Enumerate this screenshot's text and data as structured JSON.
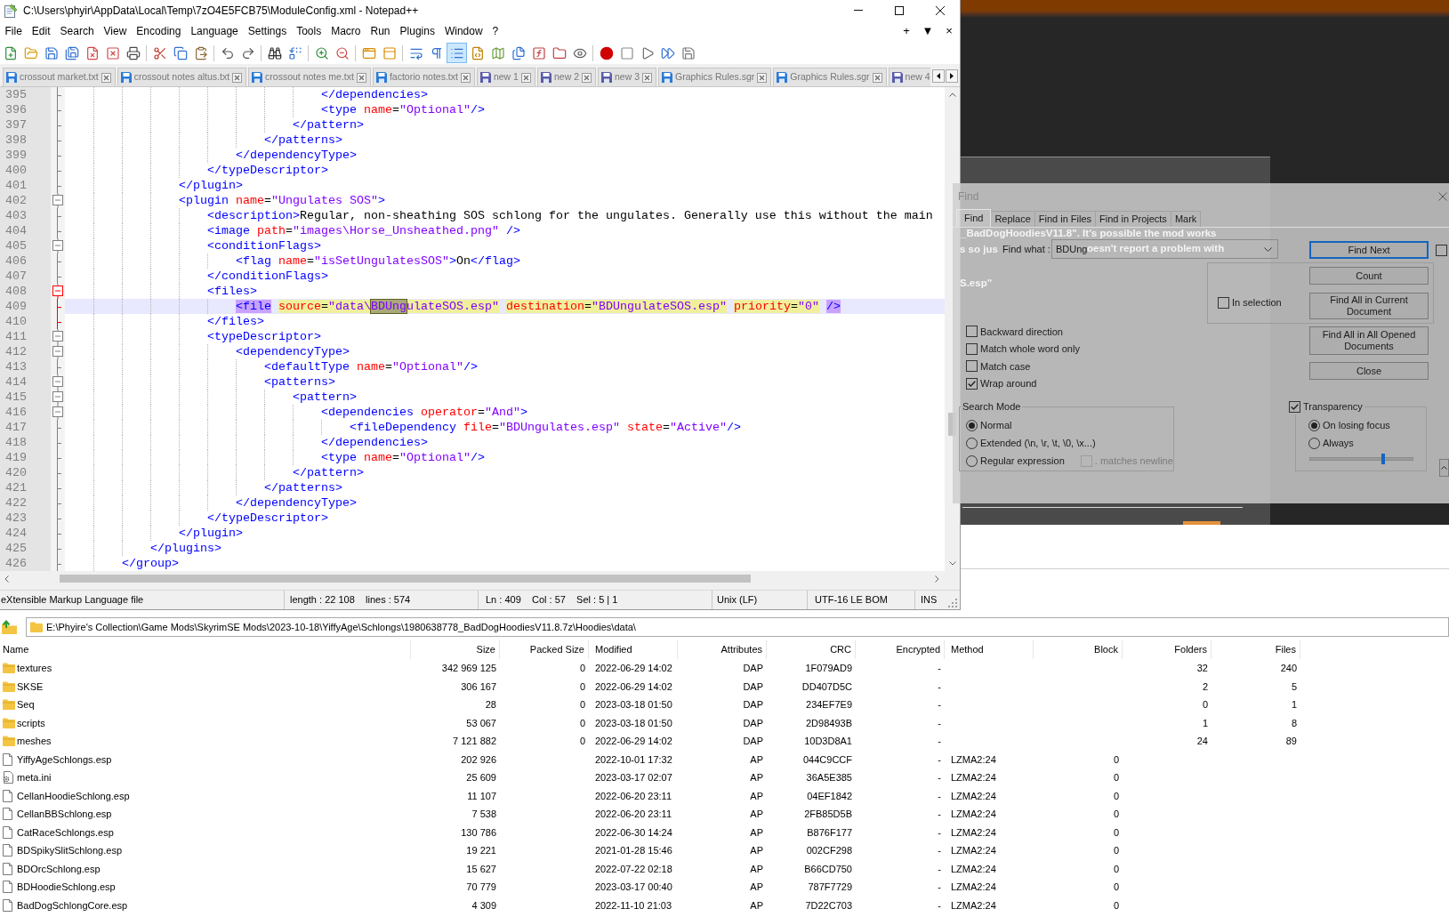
{
  "notepad": {
    "title": "C:\\Users\\phyir\\AppData\\Local\\Temp\\7zO4E5FCB75\\ModuleConfig.xml - Notepad++",
    "menu": [
      "File",
      "Edit",
      "Search",
      "View",
      "Encoding",
      "Language",
      "Settings",
      "Tools",
      "Macro",
      "Run",
      "Plugins",
      "Window",
      "?"
    ],
    "menu_right": [
      "+",
      "▼",
      "×"
    ],
    "toolbar": [
      {
        "pressed": false
      },
      {
        "pressed": false
      },
      {
        "pressed": false
      },
      {
        "pressed": false
      },
      {
        "pressed": false
      },
      {
        "pressed": false
      },
      {
        "pressed": false
      },
      {
        "pressed": false
      },
      {
        "pressed": false
      },
      {
        "pressed": false
      },
      {
        "pressed": false
      },
      {
        "pressed": false
      },
      {
        "pressed": false
      },
      {
        "pressed": false
      },
      {
        "pressed": false
      },
      {
        "pressed": false
      },
      {
        "pressed": false
      },
      {
        "pressed": false
      },
      {
        "pressed": false
      },
      {
        "pressed": false
      },
      {
        "pressed": true
      },
      {
        "pressed": false
      },
      {
        "pressed": false
      },
      {
        "pressed": false
      },
      {
        "pressed": false
      },
      {
        "pressed": false
      },
      {
        "pressed": false
      },
      {
        "pressed": false
      },
      {
        "pressed": false
      },
      {
        "pressed": false
      },
      {
        "pressed": false
      },
      {
        "pressed": false
      }
    ],
    "tabs": [
      {
        "label": "crossout market.txt",
        "selected": false,
        "color": "#2b7bd6"
      },
      {
        "label": "crossout notes altus.txt",
        "selected": false,
        "color": "#2b7bd6"
      },
      {
        "label": "crossout notes me.txt",
        "selected": false,
        "color": "#2b7bd6"
      },
      {
        "label": "factorio notes.txt",
        "selected": false,
        "color": "#2b7bd6"
      },
      {
        "label": "new 1",
        "selected": false,
        "color": "#5b5ba8"
      },
      {
        "label": "new 2",
        "selected": false,
        "color": "#5b5ba8"
      },
      {
        "label": "new 3",
        "selected": false,
        "color": "#5b5ba8"
      },
      {
        "label": "Graphics Rules.sgr",
        "selected": false,
        "color": "#2b7bd6"
      },
      {
        "label": "Graphics Rules.sgr",
        "selected": false,
        "color": "#2b7bd6"
      },
      {
        "label": "new 4",
        "selected": false,
        "color": "#5b5ba8"
      }
    ],
    "lines": [
      {
        "number": "395",
        "fold_start": false,
        "fold_active": false,
        "current": false,
        "tag_match": false,
        "parts": [
          {
            "text": "\t\t\t\t\t\t\t\t\t</dependencies>",
            "selected": false
          }
        ]
      },
      {
        "number": "396",
        "fold_start": false,
        "fold_active": false,
        "current": false,
        "tag_match": false,
        "parts": [
          {
            "text": "\t\t\t\t\t\t\t\t\t<type name=\"Optional\"/>",
            "selected": false
          }
        ]
      },
      {
        "number": "397",
        "fold_start": false,
        "fold_active": false,
        "current": false,
        "tag_match": false,
        "parts": [
          {
            "text": "\t\t\t\t\t\t\t\t</pattern>",
            "selected": false
          }
        ]
      },
      {
        "number": "398",
        "fold_start": false,
        "fold_active": false,
        "current": false,
        "tag_match": false,
        "parts": [
          {
            "text": "\t\t\t\t\t\t\t</patterns>",
            "selected": false
          }
        ]
      },
      {
        "number": "399",
        "fold_start": false,
        "fold_active": false,
        "current": false,
        "tag_match": false,
        "parts": [
          {
            "text": "\t\t\t\t\t\t</dependencyType>",
            "selected": false
          }
        ]
      },
      {
        "number": "400",
        "fold_start": false,
        "fold_active": false,
        "current": false,
        "tag_match": false,
        "parts": [
          {
            "text": "\t\t\t\t\t</typeDescriptor>",
            "selected": false
          }
        ]
      },
      {
        "number": "401",
        "fold_start": false,
        "fold_active": false,
        "current": false,
        "tag_match": false,
        "parts": [
          {
            "text": "\t\t\t\t</plugin>",
            "selected": false
          }
        ]
      },
      {
        "number": "402",
        "fold_start": true,
        "fold_active": false,
        "current": false,
        "tag_match": false,
        "parts": [
          {
            "text": "\t\t\t\t<plugin name=\"Ungulates SOS\">",
            "selected": false
          }
        ]
      },
      {
        "number": "403",
        "fold_start": false,
        "fold_active": false,
        "current": false,
        "tag_match": false,
        "parts": [
          {
            "text": "\t\t\t\t\t<description>Regular, non-sheathing SOS schlong for the ungulates. Generally use this without the main",
            "selected": false
          }
        ]
      },
      {
        "number": "404",
        "fold_start": false,
        "fold_active": false,
        "current": false,
        "tag_match": false,
        "parts": [
          {
            "text": "\t\t\t\t\t<image path=\"images\\Horse_Unsheathed.png\" />",
            "selected": false
          }
        ]
      },
      {
        "number": "405",
        "fold_start": true,
        "fold_active": false,
        "current": false,
        "tag_match": false,
        "parts": [
          {
            "text": "\t\t\t\t\t<conditionFlags>",
            "selected": false
          }
        ]
      },
      {
        "number": "406",
        "fold_start": false,
        "fold_active": false,
        "current": false,
        "tag_match": false,
        "parts": [
          {
            "text": "\t\t\t\t\t\t<flag name=\"isSetUngulatesSOS\">On</flag>",
            "selected": false
          }
        ]
      },
      {
        "number": "407",
        "fold_start": false,
        "fold_active": false,
        "current": false,
        "tag_match": false,
        "parts": [
          {
            "text": "\t\t\t\t\t</conditionFlags>",
            "selected": false
          }
        ]
      },
      {
        "number": "408",
        "fold_start": true,
        "fold_active": true,
        "current": false,
        "tag_match": false,
        "parts": [
          {
            "text": "\t\t\t\t\t<files>",
            "selected": false
          }
        ]
      },
      {
        "number": "409",
        "fold_start": false,
        "fold_active": true,
        "current": true,
        "tag_match": true,
        "parts": [
          {
            "text": "\t\t\t\t\t\t<file source=\"data\\",
            "selected": false
          },
          {
            "text": "BDUng",
            "selected": true
          },
          {
            "text": "ulateSOS.esp\" destination=\"BDUngulateSOS.esp\" priority=\"0\" />",
            "selected": false
          }
        ]
      },
      {
        "number": "410",
        "fold_start": false,
        "fold_active": true,
        "current": false,
        "tag_match": false,
        "parts": [
          {
            "text": "\t\t\t\t\t</files>",
            "selected": false
          }
        ]
      },
      {
        "number": "411",
        "fold_start": true,
        "fold_active": false,
        "current": false,
        "tag_match": false,
        "parts": [
          {
            "text": "\t\t\t\t\t<typeDescriptor>",
            "selected": false
          }
        ]
      },
      {
        "number": "412",
        "fold_start": true,
        "fold_active": false,
        "current": false,
        "tag_match": false,
        "parts": [
          {
            "text": "\t\t\t\t\t\t<dependencyType>",
            "selected": false
          }
        ]
      },
      {
        "number": "413",
        "fold_start": false,
        "fold_active": false,
        "current": false,
        "tag_match": false,
        "parts": [
          {
            "text": "\t\t\t\t\t\t\t<defaultType name=\"Optional\"/>",
            "selected": false
          }
        ]
      },
      {
        "number": "414",
        "fold_start": true,
        "fold_active": false,
        "current": false,
        "tag_match": false,
        "parts": [
          {
            "text": "\t\t\t\t\t\t\t<patterns>",
            "selected": false
          }
        ]
      },
      {
        "number": "415",
        "fold_start": true,
        "fold_active": false,
        "current": false,
        "tag_match": false,
        "parts": [
          {
            "text": "\t\t\t\t\t\t\t\t<pattern>",
            "selected": false
          }
        ]
      },
      {
        "number": "416",
        "fold_start": true,
        "fold_active": false,
        "current": false,
        "tag_match": false,
        "parts": [
          {
            "text": "\t\t\t\t\t\t\t\t\t<dependencies operator=\"And\">",
            "selected": false
          }
        ]
      },
      {
        "number": "417",
        "fold_start": false,
        "fold_active": false,
        "current": false,
        "tag_match": false,
        "parts": [
          {
            "text": "\t\t\t\t\t\t\t\t\t\t<fileDependency file=\"BDUngulates.esp\" state=\"Active\"/>",
            "selected": false
          }
        ]
      },
      {
        "number": "418",
        "fold_start": false,
        "fold_active": false,
        "current": false,
        "tag_match": false,
        "parts": [
          {
            "text": "\t\t\t\t\t\t\t\t\t</dependencies>",
            "selected": false
          }
        ]
      },
      {
        "number": "419",
        "fold_start": false,
        "fold_active": false,
        "current": false,
        "tag_match": false,
        "parts": [
          {
            "text": "\t\t\t\t\t\t\t\t\t<type name=\"Optional\"/>",
            "selected": false
          }
        ]
      },
      {
        "number": "420",
        "fold_start": false,
        "fold_active": false,
        "current": false,
        "tag_match": false,
        "parts": [
          {
            "text": "\t\t\t\t\t\t\t\t</pattern>",
            "selected": false
          }
        ]
      },
      {
        "number": "421",
        "fold_start": false,
        "fold_active": false,
        "current": false,
        "tag_match": false,
        "parts": [
          {
            "text": "\t\t\t\t\t\t\t</patterns>",
            "selected": false
          }
        ]
      },
      {
        "number": "422",
        "fold_start": false,
        "fold_active": false,
        "current": false,
        "tag_match": false,
        "parts": [
          {
            "text": "\t\t\t\t\t\t</dependencyType>",
            "selected": false
          }
        ]
      },
      {
        "number": "423",
        "fold_start": false,
        "fold_active": false,
        "current": false,
        "tag_match": false,
        "parts": [
          {
            "text": "\t\t\t\t\t</typeDescriptor>",
            "selected": false
          }
        ]
      },
      {
        "number": "424",
        "fold_start": false,
        "fold_active": false,
        "current": false,
        "tag_match": false,
        "parts": [
          {
            "text": "\t\t\t\t</plugin>",
            "selected": false
          }
        ]
      },
      {
        "number": "425",
        "fold_start": false,
        "fold_active": false,
        "current": false,
        "tag_match": false,
        "parts": [
          {
            "text": "\t\t\t</plugins>",
            "selected": false
          }
        ]
      },
      {
        "number": "426",
        "fold_start": false,
        "fold_active": false,
        "current": false,
        "tag_match": false,
        "parts": [
          {
            "text": "\t\t</group>",
            "selected": false
          }
        ]
      }
    ],
    "status_bar": [
      "eXtensible Markup Language file",
      "length : 22 108    lines : 574",
      "Ln : 409    Col : 57    Sel : 5 | 1",
      "Unix (LF)",
      "UTF-16 LE BOM",
      "INS"
    ]
  },
  "background_window": {
    "lines": [
      "_BadDogHoodiesV11.8\". It's possible the mod works",
      "s so jus",
      "oesn't report a problem with",
      "S.esp\""
    ]
  },
  "find_dialog": {
    "title": "Find",
    "tabs": [
      {
        "label": "Find",
        "selected": true
      },
      {
        "label": "Replace",
        "selected": false
      },
      {
        "label": "Find in Files",
        "selected": false
      },
      {
        "label": "Find in Projects",
        "selected": false
      },
      {
        "label": "Mark",
        "selected": false
      }
    ],
    "find_what": {
      "label": "Find what :",
      "value": "BDUng"
    },
    "buttons": [
      {
        "label": "Find Next",
        "default": true
      },
      {
        "label": "Count",
        "default": false
      },
      {
        "label": "Find All in Current Document",
        "default": false
      },
      {
        "label": "Find All in All Opened Documents",
        "default": false
      },
      {
        "label": "Close",
        "default": false
      }
    ],
    "unlabeled_checkbox": {
      "checked": false
    },
    "in_selection": {
      "label": "In selection",
      "checked": false
    },
    "options": [
      {
        "label": "Backward direction",
        "checked": false
      },
      {
        "label": "Match whole word only",
        "checked": false
      },
      {
        "label": "Match case",
        "checked": false
      },
      {
        "label": "Wrap around",
        "checked": true
      }
    ],
    "search_mode": {
      "title": "Search Mode",
      "modes": [
        {
          "label": "Normal",
          "selected": true
        },
        {
          "label": "Extended (\\n, \\r, \\t, \\0, \\x...)",
          "selected": false
        },
        {
          "label": "Regular expression",
          "selected": false
        }
      ],
      "dot_newline": {
        "label": ". matches newline",
        "checked": false,
        "disabled": true
      }
    },
    "transparency": {
      "label": "Transparency",
      "checked": true,
      "modes": [
        {
          "label": "On losing focus",
          "selected": true
        },
        {
          "label": "Always",
          "selected": false
        }
      ],
      "level": 0.71
    }
  },
  "archive": {
    "path": "E:\\Phyire's Collection\\Game Mods\\SkyrimSE Mods\\2023-10-18\\YiffyAge\\Schlongs\\1980638778_BadDogHoodiesV11.8.7z\\Hoodies\\data\\",
    "columns": [
      "Name",
      "Size",
      "Packed Size",
      "Modified",
      "Attributes",
      "CRC",
      "Encrypted",
      "Method",
      "Block",
      "Folders",
      "Files"
    ],
    "rows": [
      {
        "kind": "folder",
        "name": "textures",
        "size": "342 969 125",
        "packed_size": "0",
        "modified": "2022-06-29 14:02",
        "attributes": "DAP",
        "crc": "1F079AD9",
        "encrypted": "-",
        "folders": "32",
        "files": "240"
      },
      {
        "kind": "folder",
        "name": "SKSE",
        "size": "306 167",
        "packed_size": "0",
        "modified": "2022-06-29 14:02",
        "attributes": "DAP",
        "crc": "DD407D5C",
        "encrypted": "-",
        "folders": "2",
        "files": "5"
      },
      {
        "kind": "folder",
        "name": "Seq",
        "size": "28",
        "packed_size": "0",
        "modified": "2023-03-18 01:50",
        "attributes": "DAP",
        "crc": "234EF7E9",
        "encrypted": "-",
        "folders": "0",
        "files": "1"
      },
      {
        "kind": "folder",
        "name": "scripts",
        "size": "53 067",
        "packed_size": "0",
        "modified": "2023-03-18 01:50",
        "attributes": "DAP",
        "crc": "2D98493B",
        "encrypted": "-",
        "folders": "1",
        "files": "8"
      },
      {
        "kind": "folder",
        "name": "meshes",
        "size": "7 121 882",
        "packed_size": "0",
        "modified": "2022-06-29 14:02",
        "attributes": "DAP",
        "crc": "10D3D8A1",
        "encrypted": "-",
        "folders": "24",
        "files": "89"
      },
      {
        "kind": "file",
        "name": "YiffyAgeSchlongs.esp",
        "size": "202 926",
        "modified": "2022-10-01 17:32",
        "attributes": "AP",
        "crc": "044C9CCF",
        "encrypted": "-",
        "method": "LZMA2:24",
        "block": "0"
      },
      {
        "kind": "config",
        "name": "meta.ini",
        "size": "25 609",
        "modified": "2023-03-17 02:07",
        "attributes": "AP",
        "crc": "36A5E385",
        "encrypted": "-",
        "method": "LZMA2:24",
        "block": "0"
      },
      {
        "kind": "file",
        "name": "CellanHoodieSchlong.esp",
        "size": "11 107",
        "modified": "2022-06-20 23:11",
        "attributes": "AP",
        "crc": "04EF1842",
        "encrypted": "-",
        "method": "LZMA2:24",
        "block": "0"
      },
      {
        "kind": "file",
        "name": "CellanBBSchlong.esp",
        "size": "7 538",
        "modified": "2022-06-20 23:11",
        "attributes": "AP",
        "crc": "2FB85D5B",
        "encrypted": "-",
        "method": "LZMA2:24",
        "block": "0"
      },
      {
        "kind": "file",
        "name": "CatRaceSchlongs.esp",
        "size": "130 786",
        "modified": "2022-06-30 14:24",
        "attributes": "AP",
        "crc": "B876F177",
        "encrypted": "-",
        "method": "LZMA2:24",
        "block": "0"
      },
      {
        "kind": "file",
        "name": "BDSpikySlitSchlong.esp",
        "size": "19 221",
        "modified": "2021-01-28 15:46",
        "attributes": "AP",
        "crc": "002CF298",
        "encrypted": "-",
        "method": "LZMA2:24",
        "block": "0"
      },
      {
        "kind": "file",
        "name": "BDOrcSchlong.esp",
        "size": "15 627",
        "modified": "2022-07-22 02:18",
        "attributes": "AP",
        "crc": "B66CD750",
        "encrypted": "-",
        "method": "LZMA2:24",
        "block": "0"
      },
      {
        "kind": "file",
        "name": "BDHoodieSchlong.esp",
        "size": "70 779",
        "modified": "2023-03-17 00:40",
        "attributes": "AP",
        "crc": "787F7729",
        "encrypted": "-",
        "method": "LZMA2:24",
        "block": "0"
      },
      {
        "kind": "file",
        "name": "BadDogSchlongCore.esp",
        "size": "4 309",
        "modified": "2022-11-10 21:03",
        "attributes": "AP",
        "crc": "7D22C703",
        "encrypted": "-",
        "method": "LZMA2:24",
        "block": "0"
      }
    ]
  }
}
